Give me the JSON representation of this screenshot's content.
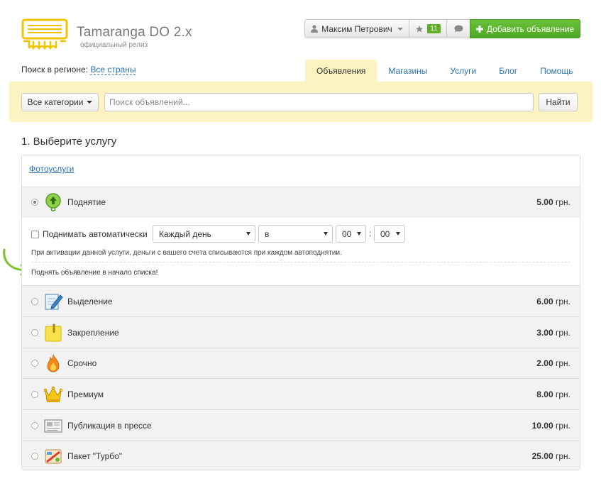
{
  "header": {
    "brand_title": "Tamaranga DO 2.x",
    "brand_subtitle": "официальный релиз",
    "user_name": "Максим Петрович",
    "favorites_count": "11",
    "add_ad_label": "Добавить объявление",
    "icons": [
      "logo-icon",
      "user-icon",
      "star-icon",
      "chat-icon",
      "plus-icon"
    ]
  },
  "region": {
    "label": "Поиск в регионе:",
    "value": "Все страны"
  },
  "tabs": [
    {
      "label": "Объявления",
      "active": true
    },
    {
      "label": "Магазины",
      "active": false
    },
    {
      "label": "Услуги",
      "active": false
    },
    {
      "label": "Блог",
      "active": false
    },
    {
      "label": "Помощь",
      "active": false
    }
  ],
  "search": {
    "category_label": "Все категории",
    "placeholder": "Поиск объявлений...",
    "find_label": "Найти"
  },
  "services": {
    "section_title": "1. Выберите услугу",
    "category_link": "Фотоуслуги",
    "currency": "грн.",
    "items": [
      {
        "name": "Поднятие",
        "price": "5.00",
        "icon": "lift-up-icon",
        "selected": true
      },
      {
        "name": "Выделение",
        "price": "6.00",
        "icon": "highlight-icon",
        "selected": false
      },
      {
        "name": "Закрепление",
        "price": "3.00",
        "icon": "pin-note-icon",
        "selected": false
      },
      {
        "name": "Срочно",
        "price": "2.00",
        "icon": "fire-icon",
        "selected": false
      },
      {
        "name": "Премиум",
        "price": "8.00",
        "icon": "crown-icon",
        "selected": false
      },
      {
        "name": "Публикация в прессе",
        "price": "10.00",
        "icon": "newspaper-icon",
        "selected": false
      },
      {
        "name": "Пакет \"Турбо\"",
        "price": "25.00",
        "icon": "turbo-package-icon",
        "selected": false
      }
    ],
    "details": {
      "auto_label": "Поднимать автоматически",
      "auto_checked": false,
      "frequency": "Каждый день",
      "day": "в",
      "hour": "00",
      "minute": "00",
      "time_separator": ":",
      "hint": "При активации данной услуги, деньги с вашего счета списываются при каждом автоподнятии.",
      "description": "Поднять объявление в начало списка!"
    }
  },
  "colors": {
    "accent_green": "#5cae24",
    "link_blue": "#2a73b7",
    "search_bar_bg": "#fdf3c1"
  }
}
